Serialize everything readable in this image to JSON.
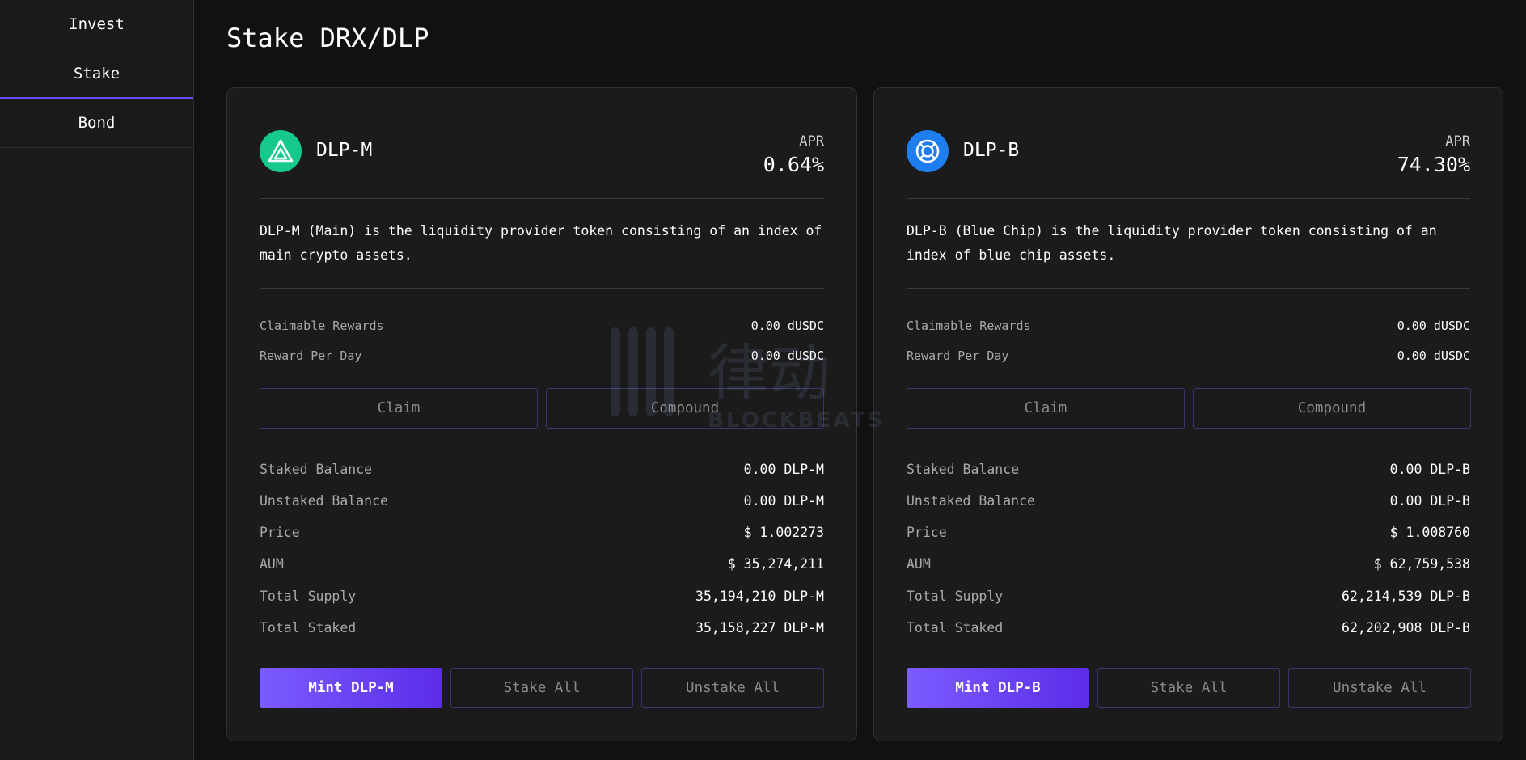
{
  "sidebar": {
    "items": [
      {
        "label": "Invest"
      },
      {
        "label": "Stake"
      },
      {
        "label": "Bond"
      }
    ],
    "active": "Stake"
  },
  "page": {
    "title": "Stake DRX/DLP"
  },
  "cards": [
    {
      "token": "DLP-M",
      "logo_icon": "triangle-icon",
      "logo_color": "#14c98a",
      "apr_label": "APR",
      "apr_value": "0.64%",
      "description": "DLP-M (Main) is the liquidity provider token consisting of an index of main crypto assets.",
      "rewards": [
        {
          "label": "Claimable Rewards",
          "value": "0.00 dUSDC"
        },
        {
          "label": "Reward Per Day",
          "value": "0.00 dUSDC"
        }
      ],
      "claim_label": "Claim",
      "compound_label": "Compound",
      "stats": [
        {
          "label": "Staked Balance",
          "value": "0.00 DLP-M"
        },
        {
          "label": "Unstaked Balance",
          "value": "0.00 DLP-M"
        },
        {
          "label": "Price",
          "value": "$ 1.002273"
        },
        {
          "label": "AUM",
          "value": "$ 35,274,211"
        },
        {
          "label": "Total Supply",
          "value": "35,194,210 DLP-M"
        },
        {
          "label": "Total Staked",
          "value": "35,158,227 DLP-M"
        }
      ],
      "mint_label": "Mint DLP-M",
      "stake_all_label": "Stake All",
      "unstake_all_label": "Unstake All"
    },
    {
      "token": "DLP-B",
      "logo_icon": "lifebuoy-icon",
      "logo_color": "#1e7ef0",
      "apr_label": "APR",
      "apr_value": "74.30%",
      "description": "DLP-B (Blue Chip) is the liquidity provider token consisting of an index of blue chip assets.",
      "rewards": [
        {
          "label": "Claimable Rewards",
          "value": "0.00 dUSDC"
        },
        {
          "label": "Reward Per Day",
          "value": "0.00 dUSDC"
        }
      ],
      "claim_label": "Claim",
      "compound_label": "Compound",
      "stats": [
        {
          "label": "Staked Balance",
          "value": "0.00 DLP-B"
        },
        {
          "label": "Unstaked Balance",
          "value": "0.00 DLP-B"
        },
        {
          "label": "Price",
          "value": "$ 1.008760"
        },
        {
          "label": "AUM",
          "value": "$ 62,759,538"
        },
        {
          "label": "Total Supply",
          "value": "62,214,539 DLP-B"
        },
        {
          "label": "Total Staked",
          "value": "62,202,908 DLP-B"
        }
      ],
      "mint_label": "Mint DLP-B",
      "stake_all_label": "Stake All",
      "unstake_all_label": "Unstake All"
    }
  ],
  "watermark": {
    "text": "律动",
    "subtext": "BLOCKBEATS"
  }
}
